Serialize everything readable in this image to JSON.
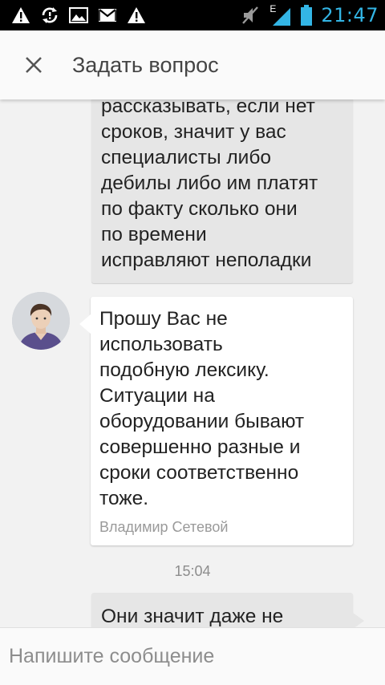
{
  "status_bar": {
    "time": "21:47",
    "network_label": "E",
    "icons": [
      "warning-icon",
      "sync-icon",
      "image-icon",
      "gmail-icon",
      "warning-icon",
      "mute-icon",
      "signal-icon",
      "battery-icon"
    ]
  },
  "app_bar": {
    "close_icon": "close-icon",
    "title": "Задать вопрос"
  },
  "messages": [
    {
      "direction": "outgoing",
      "lines": [
        "рассказывать, если нет",
        "сроков, значит у вас",
        "специалисты либо",
        "дебилы либо им платят",
        "по факту сколько они",
        "по времени",
        "исправляют неполадки"
      ]
    },
    {
      "direction": "incoming",
      "lines": [
        "Прошу Вас не",
        "использовать",
        "подобную лексику.",
        "Ситуации на",
        "оборудовании бывают",
        "совершенно разные и",
        "сроки соответственно",
        "тоже."
      ],
      "author": "Владимир Сетевой"
    },
    {
      "timestamp": "15:04"
    },
    {
      "direction": "outgoing",
      "lines": [
        "Они значит даже не"
      ]
    }
  ],
  "input": {
    "placeholder": "Напишите сообщение",
    "value": ""
  },
  "colors": {
    "status_bar": "#000000",
    "status_accent": "#33b5e5",
    "outgoing_bubble": "#e6e6e6",
    "incoming_bubble": "#ffffff",
    "background": "#f2f2f2"
  }
}
